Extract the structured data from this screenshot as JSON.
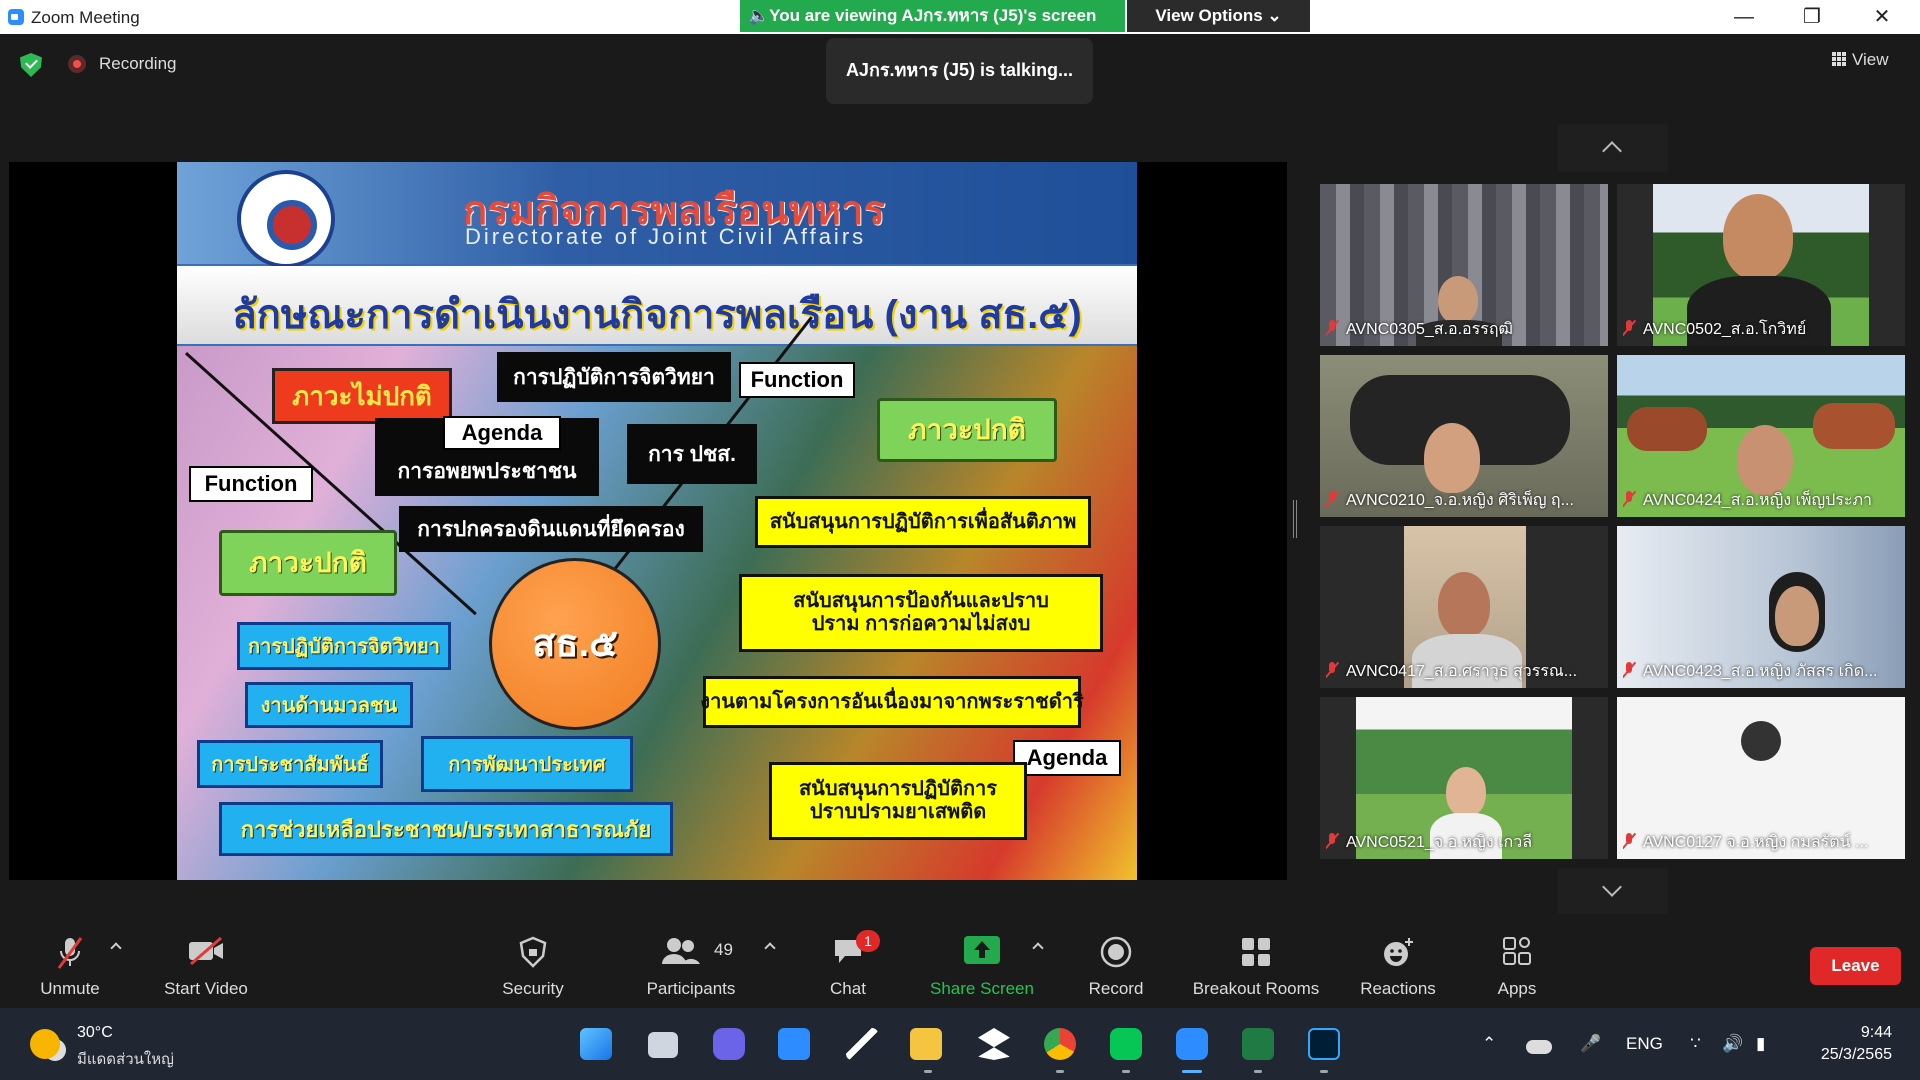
{
  "window": {
    "title": "Zoom Meeting"
  },
  "banner": {
    "viewing": "You are viewing AJกร.ทหาร (J5)'s screen",
    "view_options": "View Options"
  },
  "status": {
    "recording": "Recording",
    "talking": "AJกร.ทหาร (J5) is talking...",
    "view": "View"
  },
  "slide": {
    "title_th": "กรมกิจการพลเรือนทหาร",
    "title_en": "Directorate of Joint Civil Affairs",
    "subtitle": "ลักษณะการดำเนินงานกิจการพลเรือน (งาน สธ.๕)",
    "center": "สธ.๕",
    "labels": {
      "abnormal": "ภาวะไม่ปกติ",
      "psyops_top": "การปฏิบัติการจิตวิทยา",
      "function_top": "Function",
      "agenda_top": "Agenda",
      "evacuation": "การอพยพประชาชน",
      "pcs": "การ ปชส.",
      "normal_right": "ภาวะปกติ",
      "function_left": "Function",
      "occupied": "การปกครองดินแดนที่ยึดครอง",
      "peace_support": "สนับสนุนการปฏิบัติการเพื่อสันติภาพ",
      "normal_left": "ภาวะปกติ",
      "counter_insurgency": "สนับสนุนการป้องกันและปราบปราม การก่อความไม่สงบ",
      "psyops_left": "การปฏิบัติการจิตวิทยา",
      "mass": "งานด้านมวลชน",
      "royal_projects": "งานตามโครงการอันเนื่องมาจากพระราชดำริ",
      "public_relations": "การประชาสัมพันธ์",
      "development": "การพัฒนาประเทศ",
      "agenda_bottom": "Agenda",
      "drug_suppression": "สนับสนุนการปฏิบัติการ ปราบปรามยาเสพติด",
      "disaster_relief": "การช่วยเหลือประชาชน/บรรเทาสาธารณภัย"
    }
  },
  "participants": [
    {
      "name": "AVNC0305_ส.อ.อรรฤฒิ"
    },
    {
      "name": "AVNC0502_ส.อ.โกวิทย์"
    },
    {
      "name": "AVNC0210_จ.อ.หญิง ศิริเพ็ญ ฤ..."
    },
    {
      "name": "AVNC0424_ส.อ.หญิง เพ็ญประภา"
    },
    {
      "name": "AVNC0417_ส.อ.ศราวุธ สุวรรณ..."
    },
    {
      "name": "AVNC0423_ส.อ.หญิง ภัสสร เกิด..."
    },
    {
      "name": "AVNC0521_จ.อ.หญิง เกวลี"
    },
    {
      "name": "AVNC0127 จ.อ.หญิง กมลรัตน์ ..."
    }
  ],
  "toolbar": {
    "unmute": "Unmute",
    "start_video": "Start Video",
    "security": "Security",
    "participants": "Participants",
    "participants_count": "49",
    "chat": "Chat",
    "chat_badge": "1",
    "share_screen": "Share Screen",
    "record": "Record",
    "breakout_rooms": "Breakout Rooms",
    "reactions": "Reactions",
    "apps": "Apps",
    "leave": "Leave"
  },
  "taskbar": {
    "temperature": "30°C",
    "weather": "มีแดดส่วนใหญ่",
    "language": "ENG",
    "time": "9:44",
    "date": "25/3/2565"
  },
  "colors": {
    "share_green": "#23a94e",
    "leave_red": "#e02828",
    "zoom_blue": "#2d8cff"
  }
}
